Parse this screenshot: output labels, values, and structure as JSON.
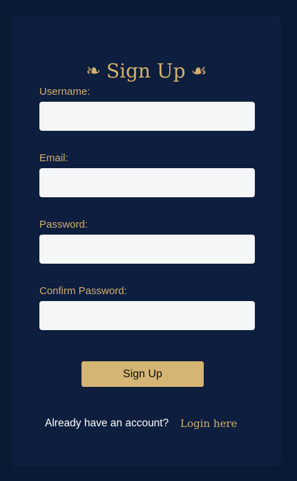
{
  "form": {
    "title": "Sign Up",
    "flourish_left": "❧",
    "flourish_right": "☙",
    "fields": [
      {
        "label": "Username:",
        "value": "",
        "placeholder": ""
      },
      {
        "label": "Email:",
        "value": "",
        "placeholder": ""
      },
      {
        "label": "Password:",
        "value": "",
        "placeholder": ""
      },
      {
        "label": "Confirm Password:",
        "value": "",
        "placeholder": ""
      }
    ],
    "submit_label": "Sign Up",
    "footer_text": "Already have an account?",
    "login_link_label": "Login here"
  },
  "colors": {
    "page_background": "#0a1a35",
    "card_background": "#0d1e3e",
    "accent_gold": "#d4b06c",
    "button_gold": "#d4b573",
    "input_background": "#f5f6f8"
  },
  "icons": {
    "flourish_left": "floral-heart-icon",
    "flourish_right": "floral-heart-icon"
  }
}
